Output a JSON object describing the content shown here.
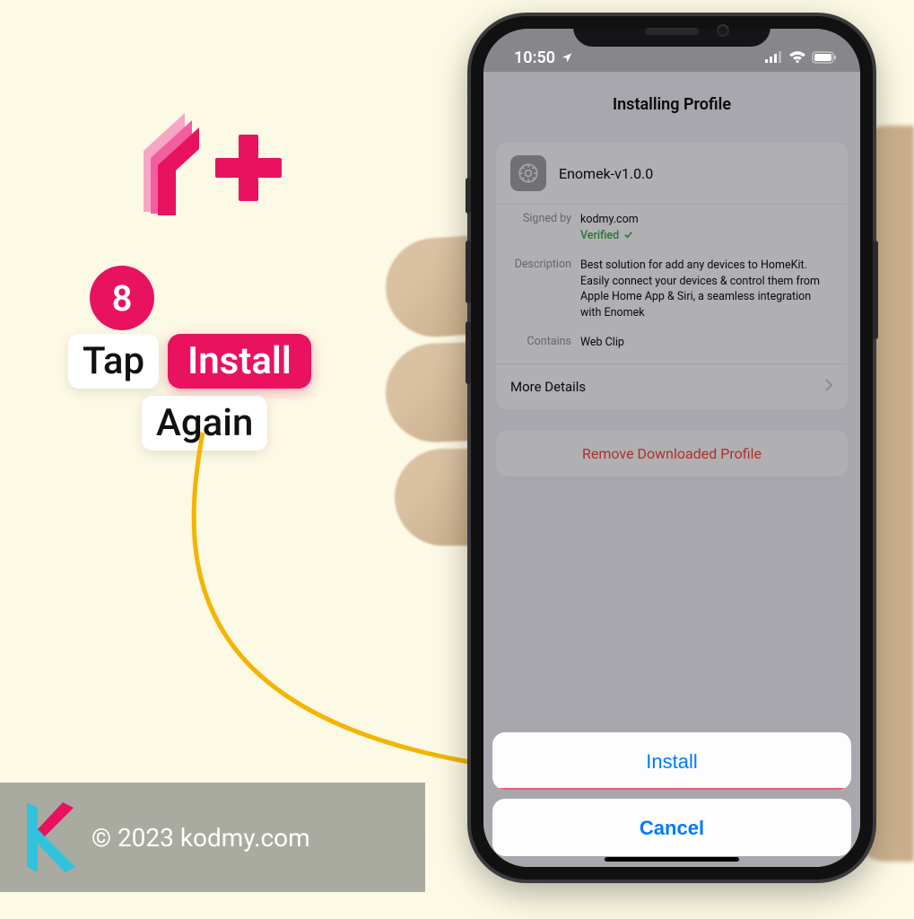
{
  "step": {
    "number": "8",
    "word_tap": "Tap",
    "word_install": "Install",
    "word_again": "Again"
  },
  "footer": {
    "copyright": "© 2023 kodmy.com"
  },
  "phone": {
    "status": {
      "time": "10:50",
      "time_suffix_icon": "B"
    },
    "page": {
      "title": "Installing Profile",
      "profile_name": "Enomek-v1.0.0",
      "signed_by_label": "Signed by",
      "signed_by_value": "kodmy.com",
      "verified_label": "Verified",
      "description_label": "Description",
      "description_value": "Best solution for add any devices to HomeKit. Easily connect your devices & control them from Apple Home App & Siri, a seamless integration with Enomek",
      "contains_label": "Contains",
      "contains_value": "Web Clip",
      "more_details": "More Details",
      "remove_profile": "Remove Downloaded Profile"
    },
    "sheet": {
      "install": "Install",
      "cancel": "Cancel"
    }
  },
  "colors": {
    "accent_pink": "#e8125f",
    "ios_blue": "#007aff",
    "ios_red": "#ff3b30",
    "verified_green": "#2aa93e"
  }
}
